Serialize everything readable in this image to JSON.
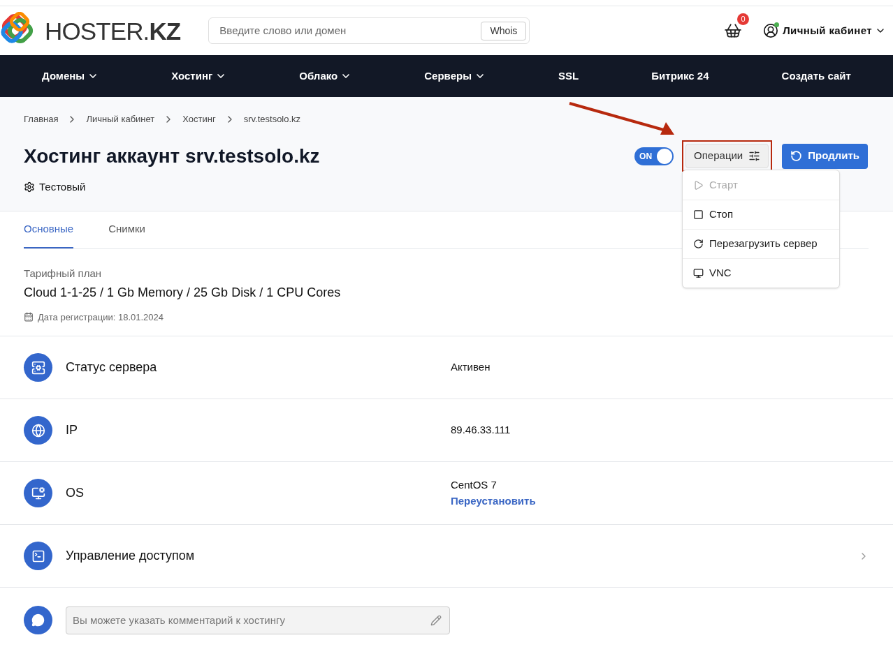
{
  "header": {
    "logo": "HOSTER.**KZ**",
    "search": {
      "placeholder": "Введите слово или домен",
      "button": "Whois"
    },
    "cart_count": "0",
    "account": "Личный кабинет"
  },
  "nav": [
    {
      "label": "Домены",
      "dropdown": true
    },
    {
      "label": "Хостинг",
      "dropdown": true
    },
    {
      "label": "Облако",
      "dropdown": true
    },
    {
      "label": "Серверы",
      "dropdown": true
    },
    {
      "label": "SSL",
      "dropdown": false
    },
    {
      "label": "Битрикс 24",
      "dropdown": false
    },
    {
      "label": "Создать сайт",
      "dropdown": false
    }
  ],
  "breadcrumbs": [
    "Главная",
    "Личный кабинет",
    "Хостинг",
    "srv.testsolo.kz"
  ],
  "title": "Хостинг аккаунт srv.testsolo.kz",
  "subtitle": "Тестовый",
  "toggle": {
    "label": "ON",
    "on": true
  },
  "operations": {
    "label": "Операции",
    "highlighted": true,
    "expanded": true,
    "items": [
      {
        "label": "Старт",
        "disabled": true
      },
      {
        "label": "Стоп",
        "disabled": false
      },
      {
        "label": "Перезагрузить сервер",
        "disabled": false
      },
      {
        "label": "VNC",
        "disabled": false
      }
    ]
  },
  "renew_button": "Продлить",
  "tabs": [
    {
      "label": "Основные",
      "selected": true
    },
    {
      "label": "Снимки",
      "selected": false
    }
  ],
  "plan": {
    "label": "Тарифный план",
    "value": "Cloud 1-1-25 / 1 Gb Memory / 25 Gb Disk / 1 CPU Cores",
    "registered": "Дата регистрации: 18.01.2024"
  },
  "rows": [
    {
      "kind": "info",
      "label": "Статус сервера",
      "value": "Активен"
    },
    {
      "kind": "info",
      "label": "IP",
      "value": "89.46.33.111"
    },
    {
      "kind": "info",
      "label": "OS",
      "value": "CentOS 7",
      "link": "Переустановить"
    },
    {
      "kind": "nav",
      "label": "Управление доступом"
    }
  ],
  "comment": {
    "placeholder": "Вы можете указать комментарий к хостингу"
  }
}
